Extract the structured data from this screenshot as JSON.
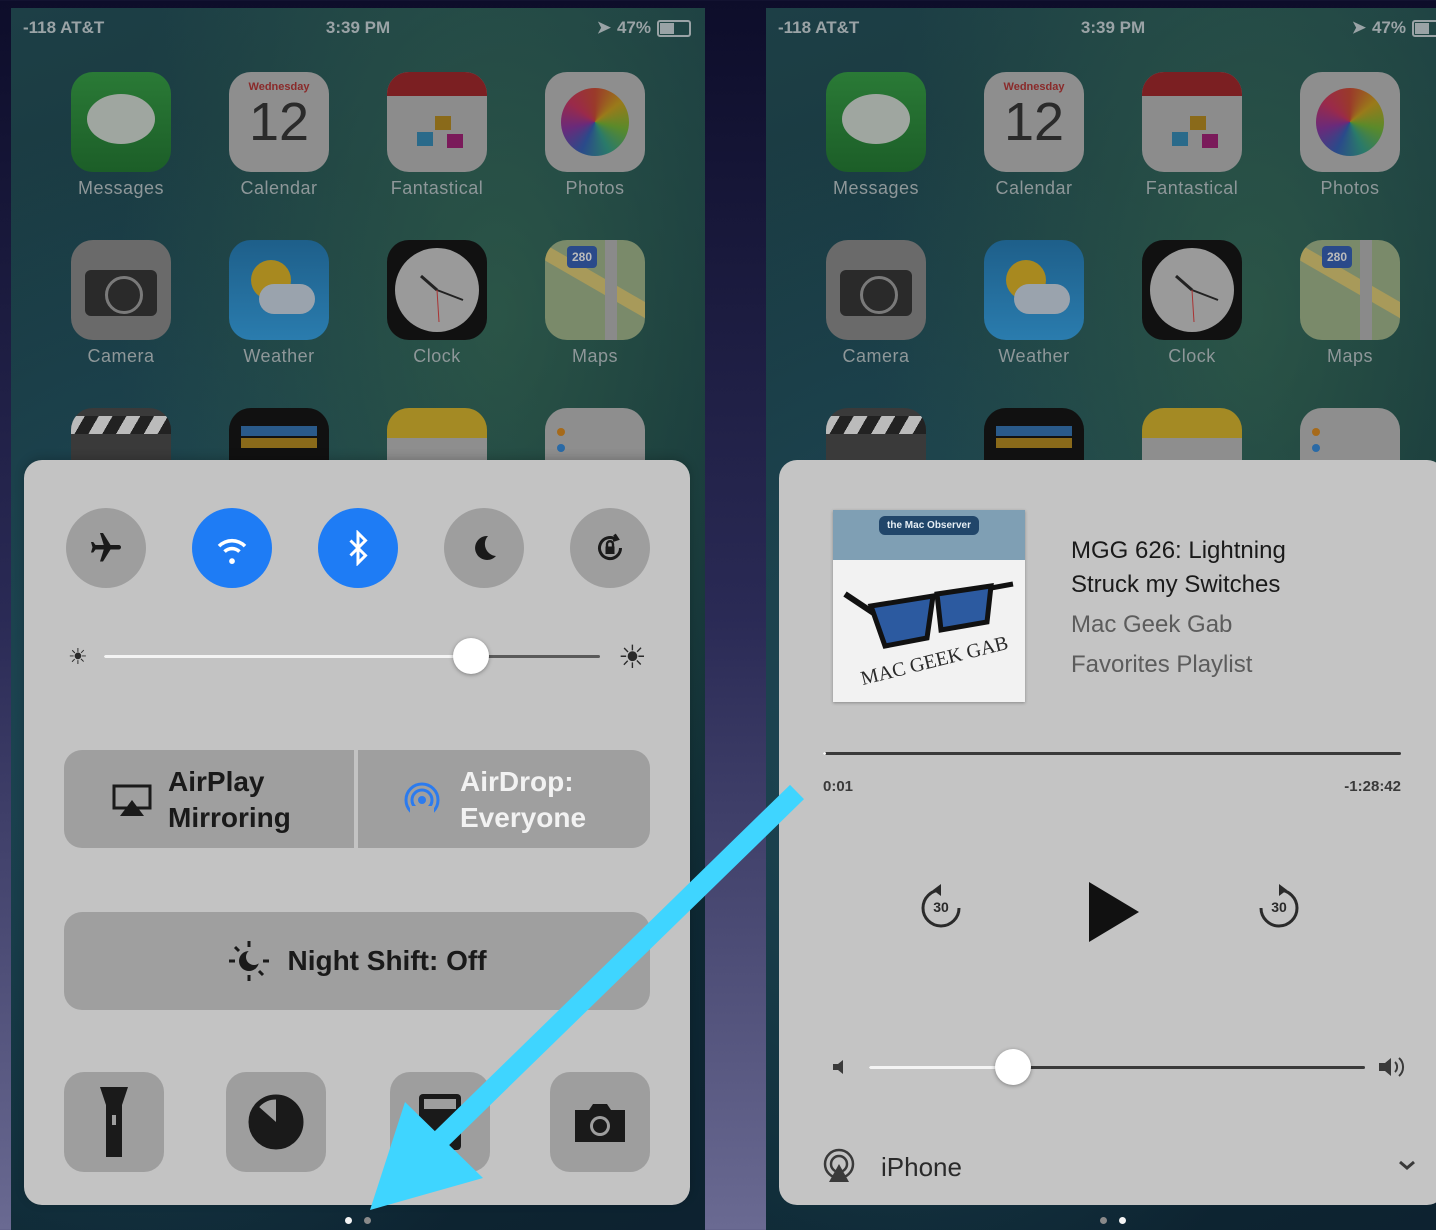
{
  "status": {
    "carrier": "-118 AT&T",
    "time": "3:39 PM",
    "battery": "47%"
  },
  "home": {
    "apps": [
      {
        "name": "Messages",
        "day": "",
        "date": ""
      },
      {
        "name": "Calendar",
        "day": "Wednesday",
        "date": "12"
      },
      {
        "name": "Fantastical",
        "day": "",
        "date": ""
      },
      {
        "name": "Photos",
        "day": "",
        "date": ""
      },
      {
        "name": "Camera",
        "day": "",
        "date": ""
      },
      {
        "name": "Weather",
        "day": "",
        "date": ""
      },
      {
        "name": "Clock",
        "day": "",
        "date": ""
      },
      {
        "name": "Maps",
        "day": "",
        "date": ""
      }
    ],
    "maps_shield": "280"
  },
  "control_center": {
    "toggles": [
      {
        "icon": "airplane-icon",
        "state": "off"
      },
      {
        "icon": "wifi-icon",
        "state": "on"
      },
      {
        "icon": "bluetooth-icon",
        "state": "on"
      },
      {
        "icon": "moon-icon",
        "state": "off"
      },
      {
        "icon": "rotation-lock-icon",
        "state": "off"
      }
    ],
    "brightness": 0.74,
    "airplay_line1": "AirPlay",
    "airplay_line2": "Mirroring",
    "airdrop_line1": "AirDrop:",
    "airdrop_line2": "Everyone",
    "night_shift": "Night Shift: Off",
    "bottom_buttons": [
      "flashlight-icon",
      "timer-icon",
      "calculator-icon",
      "camera-icon"
    ]
  },
  "now_playing": {
    "title_line1": "MGG 626: Lightning",
    "title_line2": "Struck my Switches",
    "artist": "Mac Geek Gab",
    "playlist": "Favorites Playlist",
    "artwork_badge": "the Mac Observer",
    "artwork_text": "MAC GEEK GAB",
    "elapsed": "0:01",
    "remaining": "-1:28:42",
    "progress": 0.003,
    "skip_back": "30",
    "skip_forward": "30",
    "volume": 0.29,
    "output_device": "iPhone"
  },
  "colors": {
    "accent": "#1e7cf5",
    "arrow": "#3fd5ff"
  }
}
